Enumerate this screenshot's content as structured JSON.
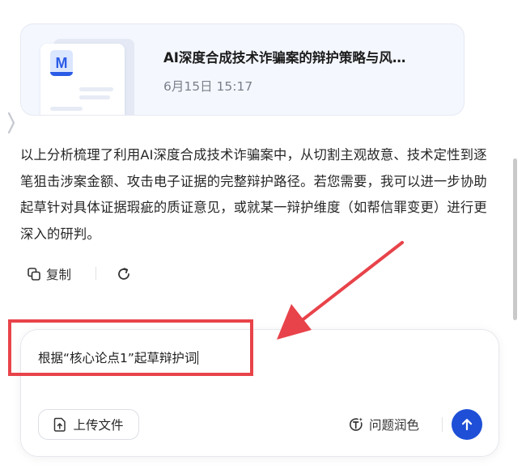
{
  "file_card": {
    "icon_letter": "M",
    "title": "AI深度合成技术诈骗案的辩护策略与风…",
    "time": "6月15日 15:17"
  },
  "message": {
    "text": "以上分析梳理了利用AI深度合成技术诈骗案中，从切割主观故意、技术定性到逐笔狙击涉案金额、攻击电子证据的完整辩护路径。若您需要，我可以进一步协助起草针对具体证据瑕疵的质证意见，或就某一辩护维度（如帮信罪变更）进行更深入的研判。"
  },
  "actions": {
    "copy_label": "复制"
  },
  "input": {
    "value": "根据“核心论点1”起草辩护词",
    "upload_label": "上传文件",
    "polish_label": "问题润色"
  },
  "colors": {
    "accent": "#1e4fd6",
    "annotation": "#e8434a"
  }
}
